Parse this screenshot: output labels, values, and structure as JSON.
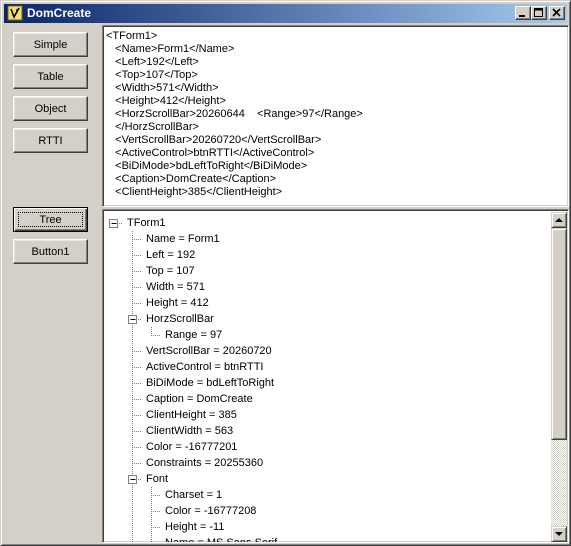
{
  "window": {
    "title": "DomCreate"
  },
  "buttons": [
    {
      "id": "simple",
      "label": "Simple"
    },
    {
      "id": "table",
      "label": "Table"
    },
    {
      "id": "object",
      "label": "Object"
    },
    {
      "id": "rtti",
      "label": "RTTI"
    },
    {
      "id": "tree",
      "label": "Tree",
      "default": true
    },
    {
      "id": "button1",
      "label": "Button1"
    }
  ],
  "memo": {
    "lines": [
      "<TForm1>",
      "   <Name>Form1</Name>",
      "   <Left>192</Left>",
      "   <Top>107</Top>",
      "   <Width>571</Width>",
      "   <Height>412</Height>",
      "   <HorzScrollBar>20260644    <Range>97</Range>",
      "   </HorzScrollBar>",
      "   <VertScrollBar>20260720</VertScrollBar>",
      "   <ActiveControl>btnRTTI</ActiveControl>",
      "   <BiDiMode>bdLeftToRight</BiDiMode>",
      "   <Caption>DomCreate</Caption>",
      "   <ClientHeight>385</ClientHeight>"
    ]
  },
  "tree": {
    "nodes": [
      {
        "text": "TForm1",
        "level": 0,
        "expandable": true
      },
      {
        "text": "Name = Form1",
        "level": 1
      },
      {
        "text": "Left = 192",
        "level": 1
      },
      {
        "text": "Top = 107",
        "level": 1
      },
      {
        "text": "Width = 571",
        "level": 1
      },
      {
        "text": "Height = 412",
        "level": 1
      },
      {
        "text": "HorzScrollBar",
        "level": 1,
        "expandable": true
      },
      {
        "text": "Range = 97",
        "level": 2
      },
      {
        "text": "VertScrollBar = 20260720",
        "level": 1
      },
      {
        "text": "ActiveControl = btnRTTI",
        "level": 1
      },
      {
        "text": "BiDiMode = bdLeftToRight",
        "level": 1
      },
      {
        "text": "Caption = DomCreate",
        "level": 1
      },
      {
        "text": "ClientHeight = 385",
        "level": 1
      },
      {
        "text": "ClientWidth = 563",
        "level": 1
      },
      {
        "text": "Color = -16777201",
        "level": 1
      },
      {
        "text": "Constraints = 20255360",
        "level": 1
      },
      {
        "text": "Font",
        "level": 1,
        "expandable": true
      },
      {
        "text": "Charset = 1",
        "level": 2
      },
      {
        "text": "Color = -16777208",
        "level": 2
      },
      {
        "text": "Height = -11",
        "level": 2
      },
      {
        "text": "Name = MS Sans Serif",
        "level": 2
      }
    ]
  },
  "scrollbar": {
    "up_icon": "arrow-up-icon",
    "down_icon": "arrow-down-icon"
  },
  "colors": {
    "title_start": "#0a246a",
    "title_end": "#a6caf0",
    "face": "#d4d0c8"
  }
}
